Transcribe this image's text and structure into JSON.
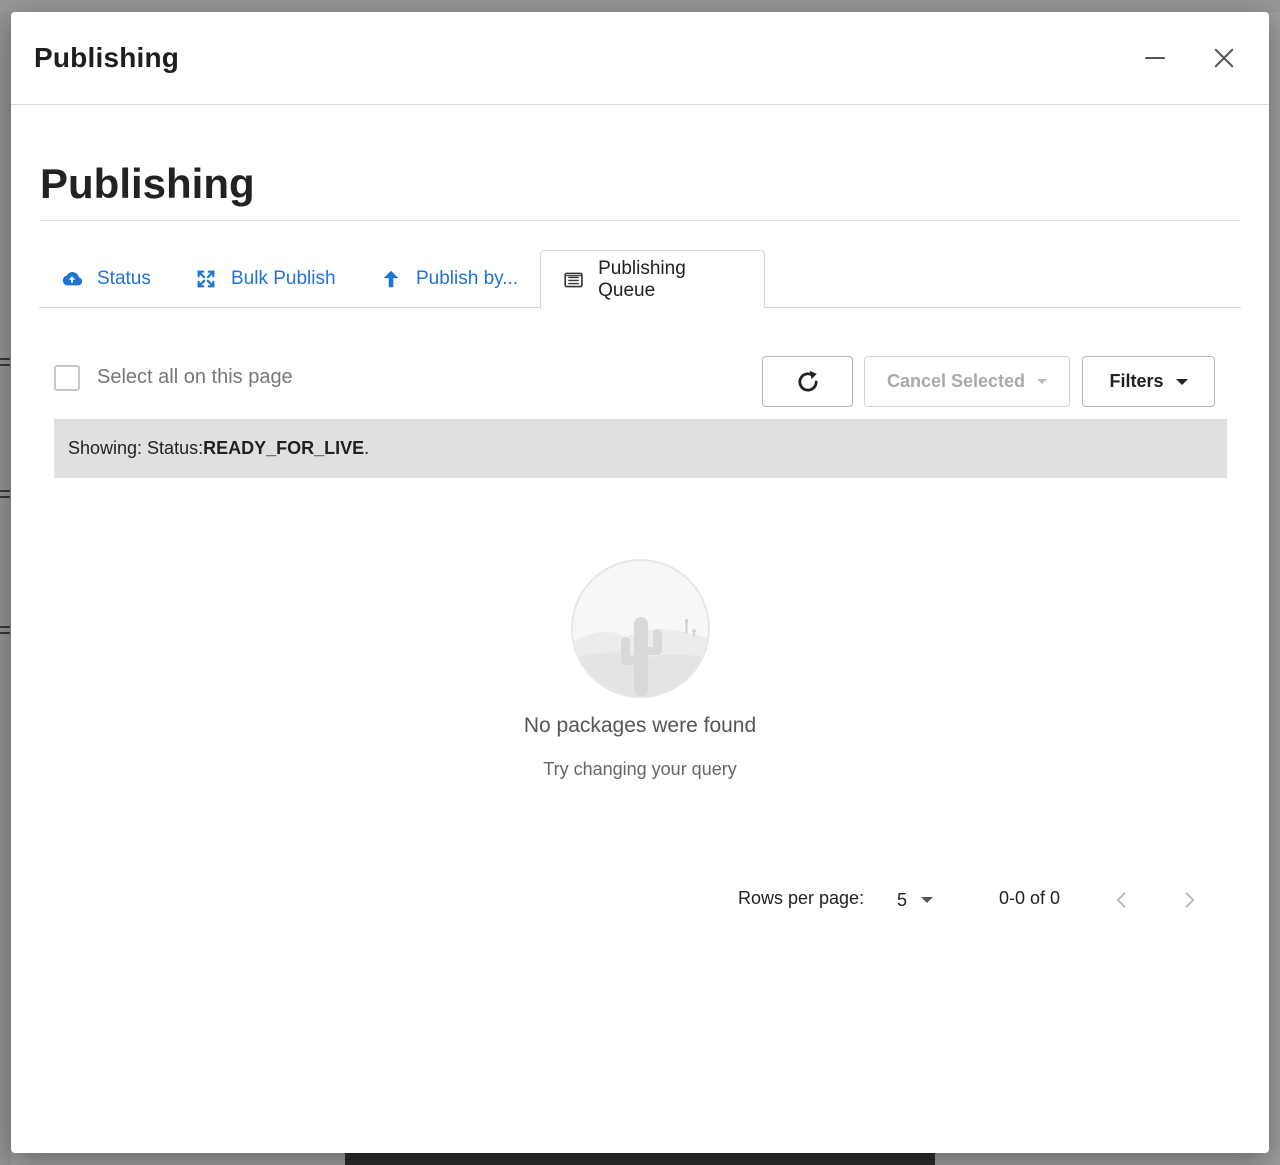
{
  "dialog": {
    "title": "Publishing",
    "minimize_icon": "minimize-icon",
    "close_icon": "close-icon"
  },
  "page": {
    "title": "Publishing"
  },
  "tabs": [
    {
      "label": "Status",
      "icon": "cloud-upload-icon",
      "active": false
    },
    {
      "label": "Bulk Publish",
      "icon": "expand-arrows-icon",
      "active": false
    },
    {
      "label": "Publish by...",
      "icon": "arrow-up-icon",
      "active": false
    },
    {
      "label": "Publishing Queue",
      "icon": "list-box-icon",
      "active": true
    }
  ],
  "toolbar": {
    "select_all_label": "Select all on this page",
    "refresh_icon": "refresh-icon",
    "cancel_label": "Cancel Selected",
    "filters_label": "Filters"
  },
  "info": {
    "prefix": "Showing: Status: ",
    "status": "READY_FOR_LIVE",
    "suffix": "."
  },
  "empty": {
    "title": "No packages were found",
    "subtitle": "Try changing your query",
    "illustration": "cactus-icon"
  },
  "pagination": {
    "rows_label": "Rows per page:",
    "rows_value": "5",
    "range": "0-0 of 0"
  },
  "colors": {
    "link_blue": "#1f74d4",
    "info_bar": "#e0e0e0"
  }
}
